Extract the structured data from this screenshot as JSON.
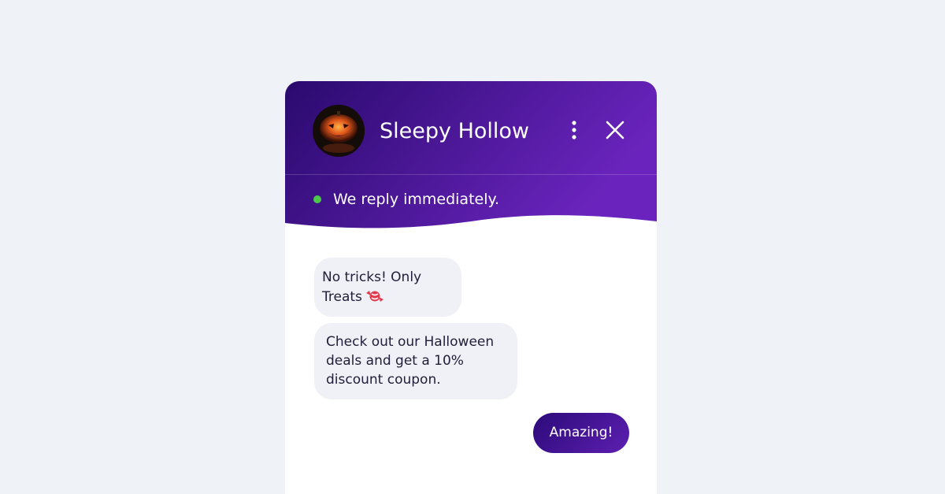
{
  "page": {
    "background": "#eff2f6"
  },
  "widget": {
    "header": {
      "title": "Sleepy Hollow",
      "avatar_icon": "jack-o-lantern",
      "menu_icon": "more-vertical-icon",
      "close_icon": "close-icon",
      "gradient_start": "#2a0a6e",
      "gradient_end": "#6a24bd"
    },
    "status": {
      "text": "We reply immediately.",
      "dot_color": "#4cc94c"
    },
    "messages": [
      {
        "from": "agent",
        "lines": [
          "No tricks! Only",
          "Treats"
        ],
        "emoji": "candy-icon"
      },
      {
        "from": "agent",
        "lines": [
          "Check out our Halloween",
          "deals and get a 10%",
          "discount coupon."
        ]
      },
      {
        "from": "user",
        "text": "Amazing!"
      }
    ]
  }
}
